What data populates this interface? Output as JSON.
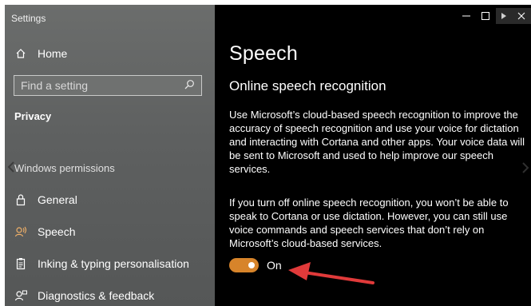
{
  "window": {
    "title": "Settings"
  },
  "titlebar": {
    "minimize_icon": "minimize-icon",
    "maximize_icon": "maximize-icon",
    "close_icon": "close-icon"
  },
  "sidebar": {
    "home_label": "Home",
    "search_placeholder": "Find a setting",
    "category": "Privacy",
    "group_heading": "Windows permissions",
    "items": [
      {
        "label": "General",
        "icon": "lock-icon",
        "active": false
      },
      {
        "label": "Speech",
        "icon": "speech-icon",
        "active": true
      },
      {
        "label": "Inking & typing personalisation",
        "icon": "clipboard-icon",
        "active": false
      },
      {
        "label": "Diagnostics & feedback",
        "icon": "feedback-icon",
        "active": false
      }
    ]
  },
  "main": {
    "page_title": "Speech",
    "section_title": "Online speech recognition",
    "paragraph1": "Use Microsoft’s cloud-based speech recognition to improve the accuracy of speech recognition and use your voice for dictation and interacting with Cortana and other apps. Your voice data will be sent to Microsoft and used to help improve our speech services.",
    "paragraph2": "If you turn off online speech recognition, you won’t be able to speak to Cortana or use dictation. However, you can still use voice commands and speech services that don’t rely on Microsoft’s cloud-based services.",
    "toggle": {
      "label": "On",
      "state": true
    }
  },
  "colors": {
    "accent": "#d7842a",
    "annotation_arrow": "#e03a3a"
  }
}
